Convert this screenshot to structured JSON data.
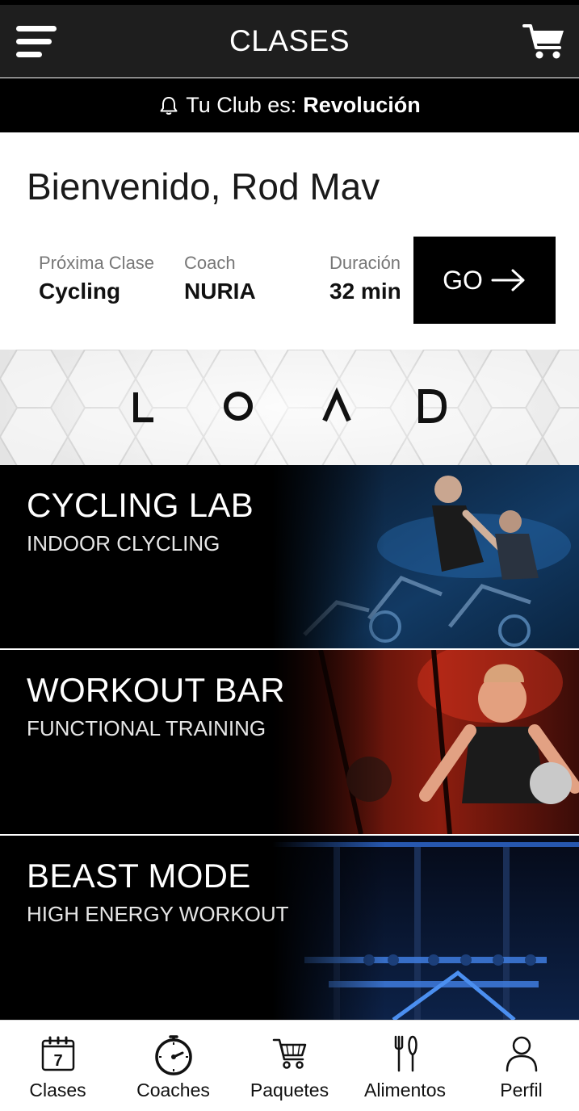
{
  "appbar": {
    "title": "CLASES",
    "menu_icon": "hamburger-menu-icon",
    "cart_icon": "shopping-cart-icon"
  },
  "club": {
    "prefix": "Tu Club es:",
    "name": "Revolución",
    "icon": "bell-icon"
  },
  "welcome": "Bienvenido, Rod Mav",
  "next_class": {
    "class_label": "Próxima Clase",
    "class_value": "Cycling",
    "coach_label": "Coach",
    "coach_value": "NURIA",
    "duration_label": "Duración",
    "duration_value": "32 min",
    "go_label": "GO"
  },
  "banner": {
    "letters": [
      "L",
      "O",
      "A",
      "D"
    ]
  },
  "classes": [
    {
      "title": "CYCLING LAB",
      "subtitle": "INDOOR CLYCLING",
      "accent": "#3a8fd8"
    },
    {
      "title": "WORKOUT BAR",
      "subtitle": "FUNCTIONAL TRAINING",
      "accent": "#e0351e"
    },
    {
      "title": "BEAST MODE",
      "subtitle": "HIGH ENERGY WORKOUT",
      "accent": "#2f6bd6"
    }
  ],
  "tabs": [
    {
      "label": "Clases",
      "icon": "calendar-icon",
      "calendar_day": "7"
    },
    {
      "label": "Coaches",
      "icon": "stopwatch-icon"
    },
    {
      "label": "Paquetes",
      "icon": "shopping-cart-icon"
    },
    {
      "label": "Alimentos",
      "icon": "fork-knife-icon"
    },
    {
      "label": "Perfil",
      "icon": "user-icon"
    }
  ],
  "colors": {
    "appbar_bg": "#1e1e1e",
    "club_bar_bg": "#000000",
    "go_button_bg": "#000000",
    "card_bg": "#000000"
  }
}
